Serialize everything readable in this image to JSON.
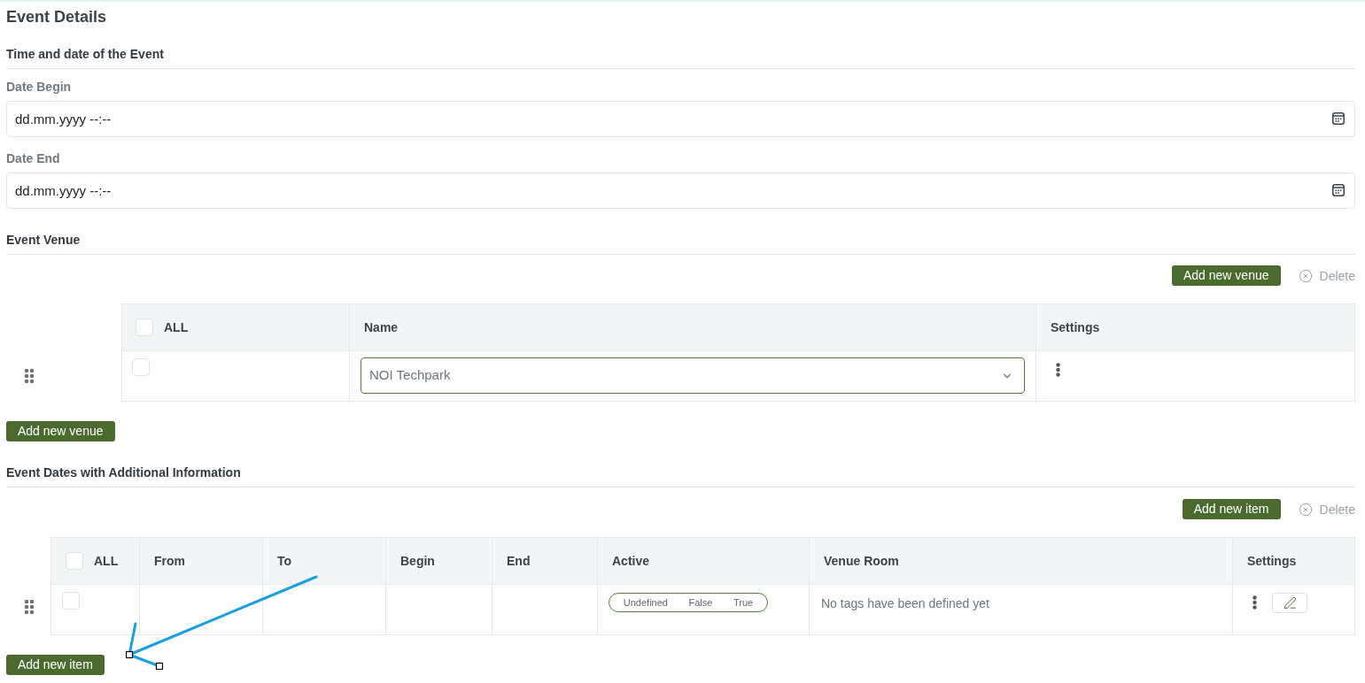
{
  "title": "Event Details",
  "schedule": {
    "heading": "Time and date of the Event",
    "fields": [
      {
        "label": "Date Begin",
        "placeholder": "dd.mm.yyyy --:--"
      },
      {
        "label": "Date End",
        "placeholder": "dd.mm.yyyy --:--"
      }
    ]
  },
  "venues": {
    "heading": "Event Venue",
    "add_button": "Add new venue",
    "delete_button": {
      "label": "Delete",
      "disabled": true
    },
    "table": {
      "select_all": {
        "label": "ALL",
        "checked": false
      },
      "columns": [
        "Name",
        "Settings"
      ],
      "rows": [
        {
          "checked": false,
          "name": "NOI Techpark"
        }
      ]
    },
    "footer_button": "Add new venue"
  },
  "event_dates": {
    "heading": "Event Dates with Additional Information",
    "add_button": "Add new item",
    "delete_button": {
      "label": "Delete",
      "disabled": true
    },
    "table": {
      "select_all": {
        "label": "ALL",
        "checked": false
      },
      "columns": [
        "From",
        "To",
        "Begin",
        "End",
        "Active",
        "Venue Room",
        "Settings"
      ],
      "rows": [
        {
          "checked": false,
          "active": [
            {
              "label": "Undefined",
              "selected": false
            },
            {
              "label": "False",
              "selected": false
            },
            {
              "label": "True",
              "selected": false
            }
          ],
          "venue_room": "No tags have been defined yet"
        }
      ]
    },
    "footer_button": "Add new item"
  }
}
